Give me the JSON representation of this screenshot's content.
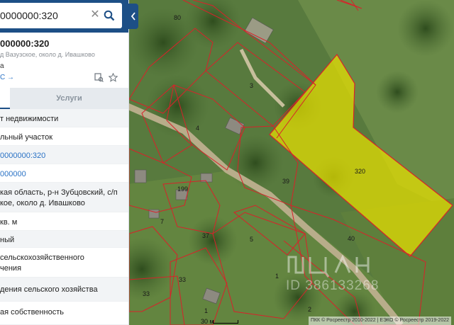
{
  "search": {
    "value": "0000000:320",
    "clear_icon": "close-icon",
    "search_icon": "search-icon"
  },
  "panel": {
    "title": "000000:320",
    "address_small": "д Вазузское, около д. Ивашково",
    "status": "а",
    "link": "С →",
    "icons": [
      "copy-link-icon",
      "star-icon"
    ],
    "tabs": {
      "second": "Услуги"
    },
    "rows": [
      {
        "text": "т недвижимости"
      },
      {
        "text": "льный участок"
      },
      {
        "text": "0000000:320",
        "link": true
      },
      {
        "text": "000000",
        "link": true
      },
      {
        "text": "кая область, р-н Зубцовский, с/п",
        "text2": "кое, около д. Ивашково"
      },
      {
        "text": "кв. м"
      },
      {
        "text": "ный"
      },
      {
        "text": "сельскохозяйственного",
        "text2": "чения"
      },
      {
        "text": "дения сельского хозяйства"
      },
      {
        "text": "ая собственность"
      }
    ]
  },
  "map": {
    "parcel_labels": [
      "80",
      "3",
      "4",
      "199",
      "39",
      "320",
      "37",
      "5",
      "40",
      "33",
      "1",
      "33",
      "2",
      "1",
      "7"
    ],
    "selected_parcel": "320",
    "highlight_color": "#e8e000",
    "boundary_color": "#d8222a",
    "attribution": "ПКК © Росреестр 2010-2022 | ЕЭКО © Росреестр 2019-2022",
    "scale": "30 м",
    "watermark_id": "ID 386133268"
  }
}
